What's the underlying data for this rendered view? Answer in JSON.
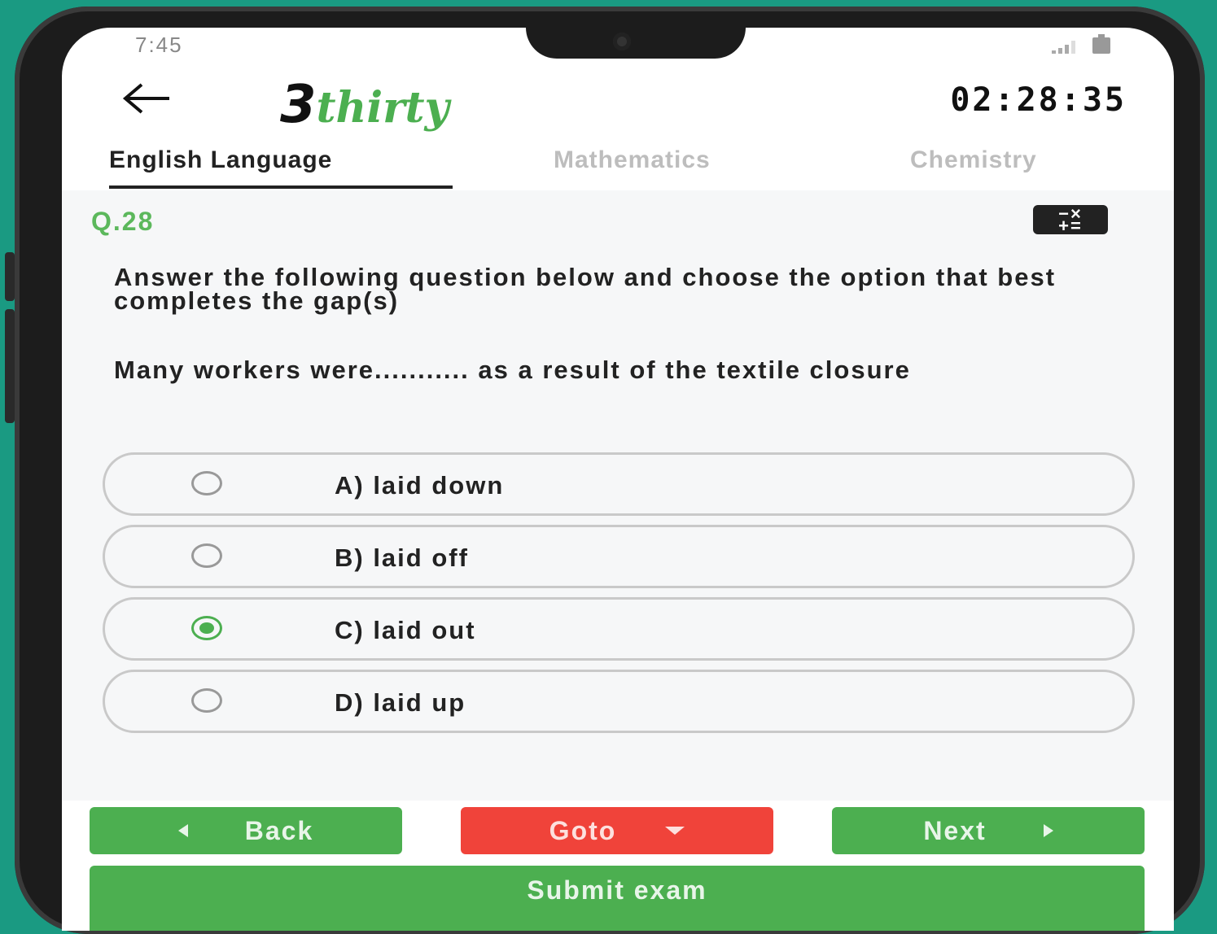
{
  "status_bar": {
    "time": "7:45"
  },
  "header": {
    "logo_number": "3",
    "logo_word": "thirty",
    "timer": "02:28:35"
  },
  "tabs": [
    {
      "label": "English Language",
      "active": true
    },
    {
      "label": "Mathematics",
      "active": false
    },
    {
      "label": "Chemistry",
      "active": false
    }
  ],
  "question": {
    "number": "Q.28",
    "instruction": "Answer the following question below and choose the option that best completes the gap(s)",
    "text": "Many workers were........... as a result of the textile closure",
    "options": [
      {
        "label": "A) laid down",
        "selected": false
      },
      {
        "label": "B) laid off",
        "selected": false
      },
      {
        "label": "C) laid out",
        "selected": true
      },
      {
        "label": "D) laid up",
        "selected": false
      }
    ]
  },
  "navigation": {
    "back_label": "Back",
    "goto_label": "Goto",
    "next_label": "Next",
    "submit_label": "Submit exam"
  },
  "colors": {
    "accent": "#4caf50",
    "danger": "#f0433a",
    "background": "#1a9a82"
  },
  "icons": {
    "back": "arrow-left-icon",
    "calculator": "calculator-icon",
    "signal": "signal-icon",
    "battery": "battery-icon"
  }
}
